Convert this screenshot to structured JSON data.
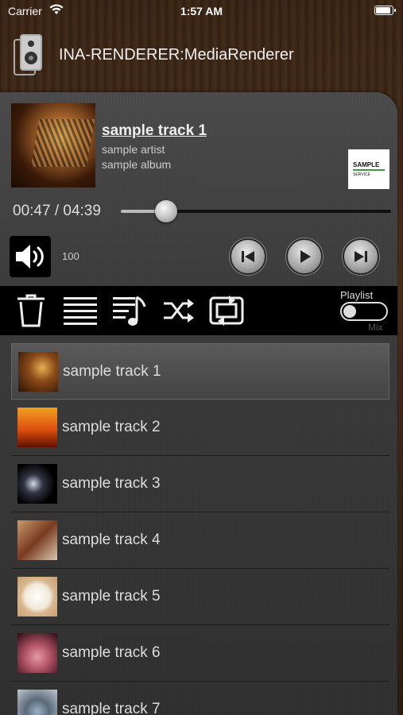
{
  "status_bar": {
    "carrier": "Carrier",
    "time": "1:57 AM"
  },
  "header": {
    "device_name": "INA-RENDERER:MediaRenderer",
    "icon": "speaker-icon"
  },
  "now_playing": {
    "track": "sample track 1",
    "artist": "sample artist",
    "album": "sample album",
    "service_logo": {
      "line1": "SAMPLE",
      "line2": "SERVICE"
    }
  },
  "playback": {
    "time_display": "00:47 / 04:39",
    "progress": 0.168
  },
  "volume": {
    "value": "100",
    "icon": "speaker-volume-icon"
  },
  "transport": {
    "prev_icon": "skip-previous-icon",
    "play_icon": "play-icon",
    "next_icon": "skip-next-icon"
  },
  "toolbar": {
    "icons": [
      "trash-icon",
      "list-icon",
      "music-list-icon",
      "shuffle-icon",
      "repeat-icon"
    ],
    "playlist_label": "Playlist",
    "mix_label": "Mix",
    "toggle_on": false
  },
  "playlist": {
    "tracks": [
      {
        "title": "sample track 1",
        "selected": true
      },
      {
        "title": "sample track 2",
        "selected": false
      },
      {
        "title": "sample track 3",
        "selected": false
      },
      {
        "title": "sample track 4",
        "selected": false
      },
      {
        "title": "sample track 5",
        "selected": false
      },
      {
        "title": "sample track 6",
        "selected": false
      },
      {
        "title": "sample track 7",
        "selected": false
      }
    ]
  },
  "colors": {
    "accent_green": "#3a9a3a",
    "panel_bg": "#3b3b3b",
    "toolbar_bg": "#000000"
  }
}
